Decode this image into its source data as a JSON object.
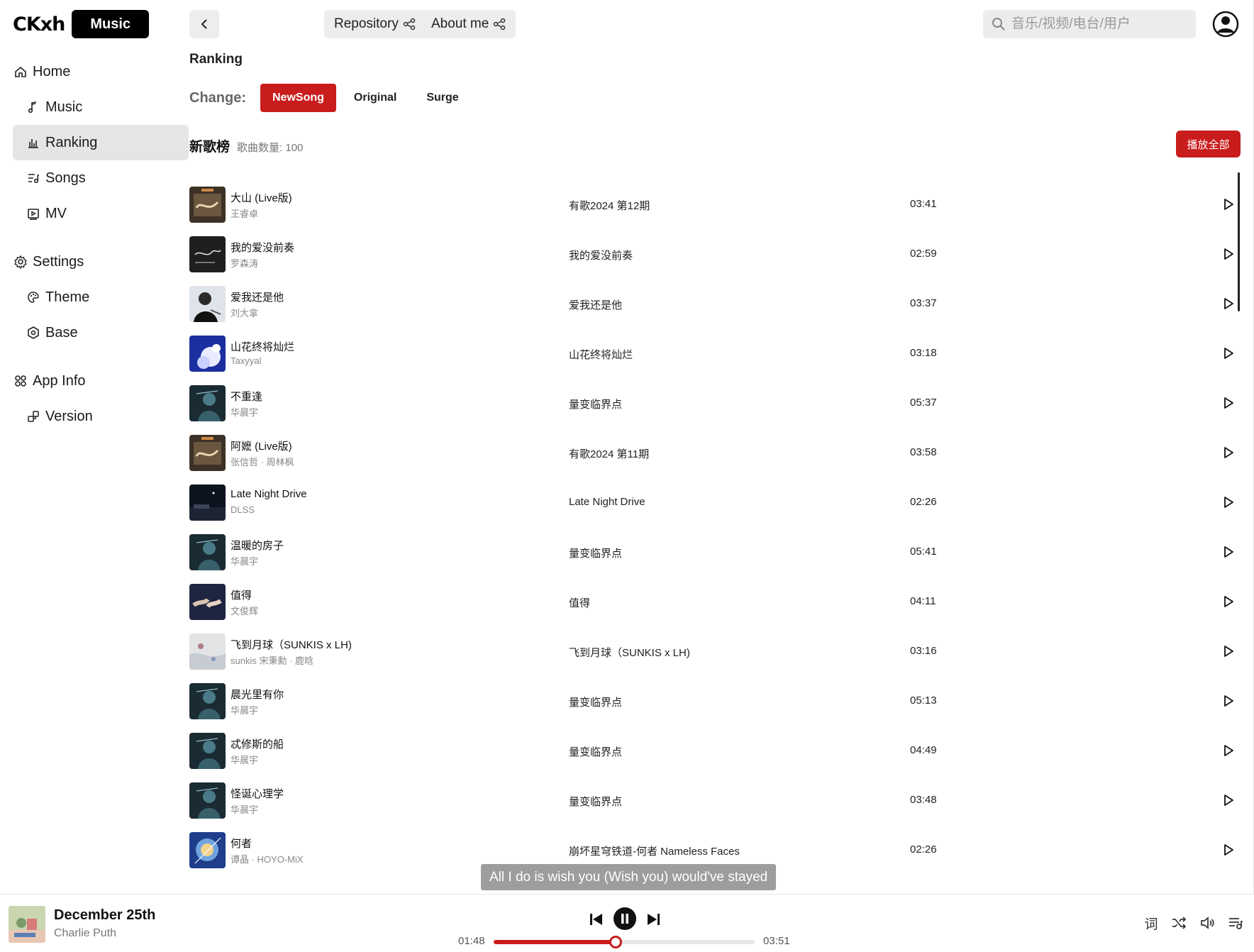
{
  "app": {
    "logo_text": "CKxh",
    "logo_badge": "Music"
  },
  "sidebar": {
    "items": [
      {
        "label": "Home",
        "icon": "home-icon",
        "level": "top",
        "active": false
      },
      {
        "label": "Music",
        "icon": "music-note-icon",
        "level": "sub",
        "active": false
      },
      {
        "label": "Ranking",
        "icon": "bar-chart-icon",
        "level": "sub",
        "active": true
      },
      {
        "label": "Songs",
        "icon": "playlist-icon",
        "level": "sub",
        "active": false
      },
      {
        "label": "MV",
        "icon": "video-icon",
        "level": "sub",
        "active": false
      },
      {
        "label": "Settings",
        "icon": "gear-icon",
        "level": "top",
        "active": false
      },
      {
        "label": "Theme",
        "icon": "palette-icon",
        "level": "sub",
        "active": false
      },
      {
        "label": "Base",
        "icon": "hexagon-icon",
        "level": "sub",
        "active": false
      },
      {
        "label": "App Info",
        "icon": "apps-icon",
        "level": "top",
        "active": false
      },
      {
        "label": "Version",
        "icon": "version-icon",
        "level": "sub",
        "active": false
      }
    ]
  },
  "topbar": {
    "repository_label": "Repository",
    "about_label": "About me",
    "search_placeholder": "音乐/视频/电台/用户"
  },
  "page": {
    "title": "Ranking",
    "change_label": "Change:",
    "tabs": [
      {
        "label": "NewSong",
        "active": true
      },
      {
        "label": "Original",
        "active": false
      },
      {
        "label": "Surge",
        "active": false
      }
    ],
    "list_title": "新歌榜",
    "list_count": "歌曲数量: 100",
    "play_all_label": "播放全部"
  },
  "songs": [
    {
      "name": "大山 (Live版)",
      "artist": "王睿卓",
      "album": "有歌2024 第12期",
      "duration": "03:41",
      "cover": "youge"
    },
    {
      "name": "我的爱没前奏",
      "artist": "罗森涛",
      "album": "我的爱没前奏",
      "duration": "02:59",
      "cover": "dark"
    },
    {
      "name": "爱我还是他",
      "artist": "刘大拿",
      "album": "爱我还是他",
      "duration": "03:37",
      "cover": "portrait"
    },
    {
      "name": "山花终将灿烂",
      "artist": "Taxyyal",
      "album": "山花终将灿烂",
      "duration": "03:18",
      "cover": "blue"
    },
    {
      "name": "不重逢",
      "artist": "华晨宇",
      "album": "量变临界点",
      "duration": "05:37",
      "cover": "teal"
    },
    {
      "name": "阿嬷 (Live版)",
      "artist": "张信哲 · 周林枫",
      "album": "有歌2024 第11期",
      "duration": "03:58",
      "cover": "youge"
    },
    {
      "name": "Late Night Drive",
      "artist": "DLSS",
      "album": "Late Night Drive",
      "duration": "02:26",
      "cover": "night"
    },
    {
      "name": "温暖的房子",
      "artist": "华晨宇",
      "album": "量变临界点",
      "duration": "05:41",
      "cover": "teal"
    },
    {
      "name": "值得",
      "artist": "文俊辉",
      "album": "值得",
      "duration": "04:11",
      "cover": "hands"
    },
    {
      "name": "飞到月球（SUNKIS x LH)",
      "artist": "sunkis 宋秉勳 · 鹿晗",
      "album": "飞到月球（SUNKIS x LH)",
      "duration": "03:16",
      "cover": "pale"
    },
    {
      "name": "晨光里有你",
      "artist": "华晨宇",
      "album": "量变临界点",
      "duration": "05:13",
      "cover": "teal"
    },
    {
      "name": "忒修斯的船",
      "artist": "华晨宇",
      "album": "量变临界点",
      "duration": "04:49",
      "cover": "teal"
    },
    {
      "name": "怪诞心理学",
      "artist": "华晨宇",
      "album": "量变临界点",
      "duration": "03:48",
      "cover": "teal"
    },
    {
      "name": "何者",
      "artist": "谭晶 · HOYO-MiX",
      "album": "崩坏星穹铁道-何者 Nameless Faces",
      "duration": "02:26",
      "cover": "game"
    }
  ],
  "lyric_line": "All I do is wish you (Wish you) would've stayed",
  "player": {
    "title": "December 25th",
    "artist": "Charlie Puth",
    "current_time": "01:48",
    "total_time": "03:51",
    "progress": 0.4675,
    "lyric_button_label": "词"
  },
  "colors": {
    "accent": "#c91c1c",
    "active_nav_bg": "#e5e5e5",
    "button_bg": "#ededed"
  }
}
